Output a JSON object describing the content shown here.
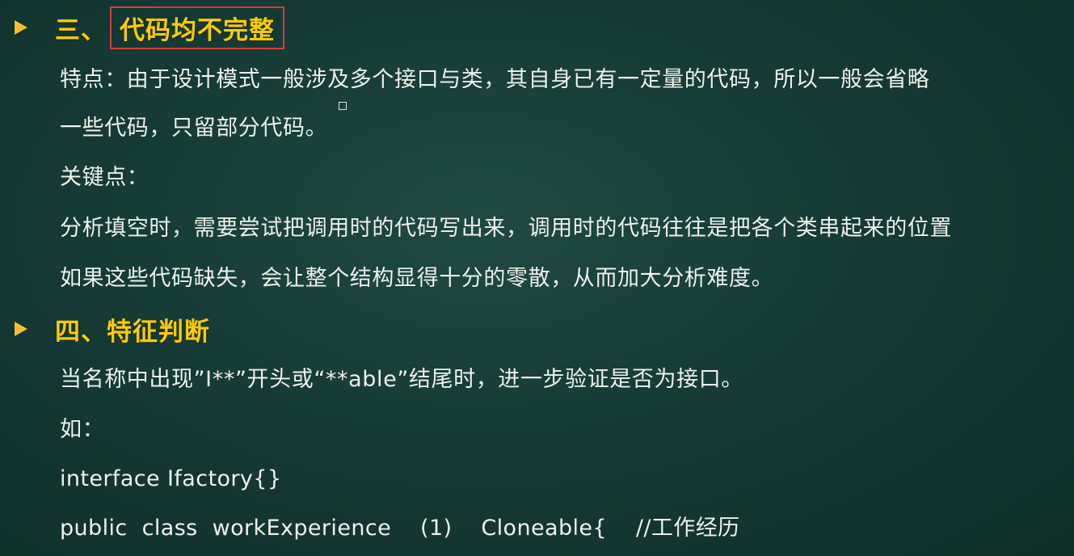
{
  "section3": {
    "prefix": "三、",
    "title": "代码均不完整"
  },
  "section3_body": {
    "line1": "特点：由于设计模式一般涉及多个接口与类，其自身已有一定量的代码，所以一般会省略",
    "line2": "一些代码，只留部分代码。",
    "line3": "关键点：",
    "line4": "分析填空时，需要尝试把调用时的代码写出来，调用时的代码往往是把各个类串起来的位置",
    "line5": "如果这些代码缺失，会让整个结构显得十分的零散，从而加大分析难度。"
  },
  "section4": {
    "title": "四、特征判断"
  },
  "section4_body": {
    "line1": "当名称中出现”I**”开头或“**able”结尾时，进一步验证是否为接口。",
    "line2": "如：",
    "line3": "interface Ifactory{}",
    "line4": "public  class  workExperience    (1)    Cloneable{    //工作经历"
  },
  "icons": {
    "bullet": "arrow-bullet-icon",
    "marker": "small-square-icon"
  },
  "colors": {
    "background": "#163b36",
    "heading": "#ffcc00",
    "highlight_box": "#d93a3a",
    "body_text": "#eef3ee"
  }
}
